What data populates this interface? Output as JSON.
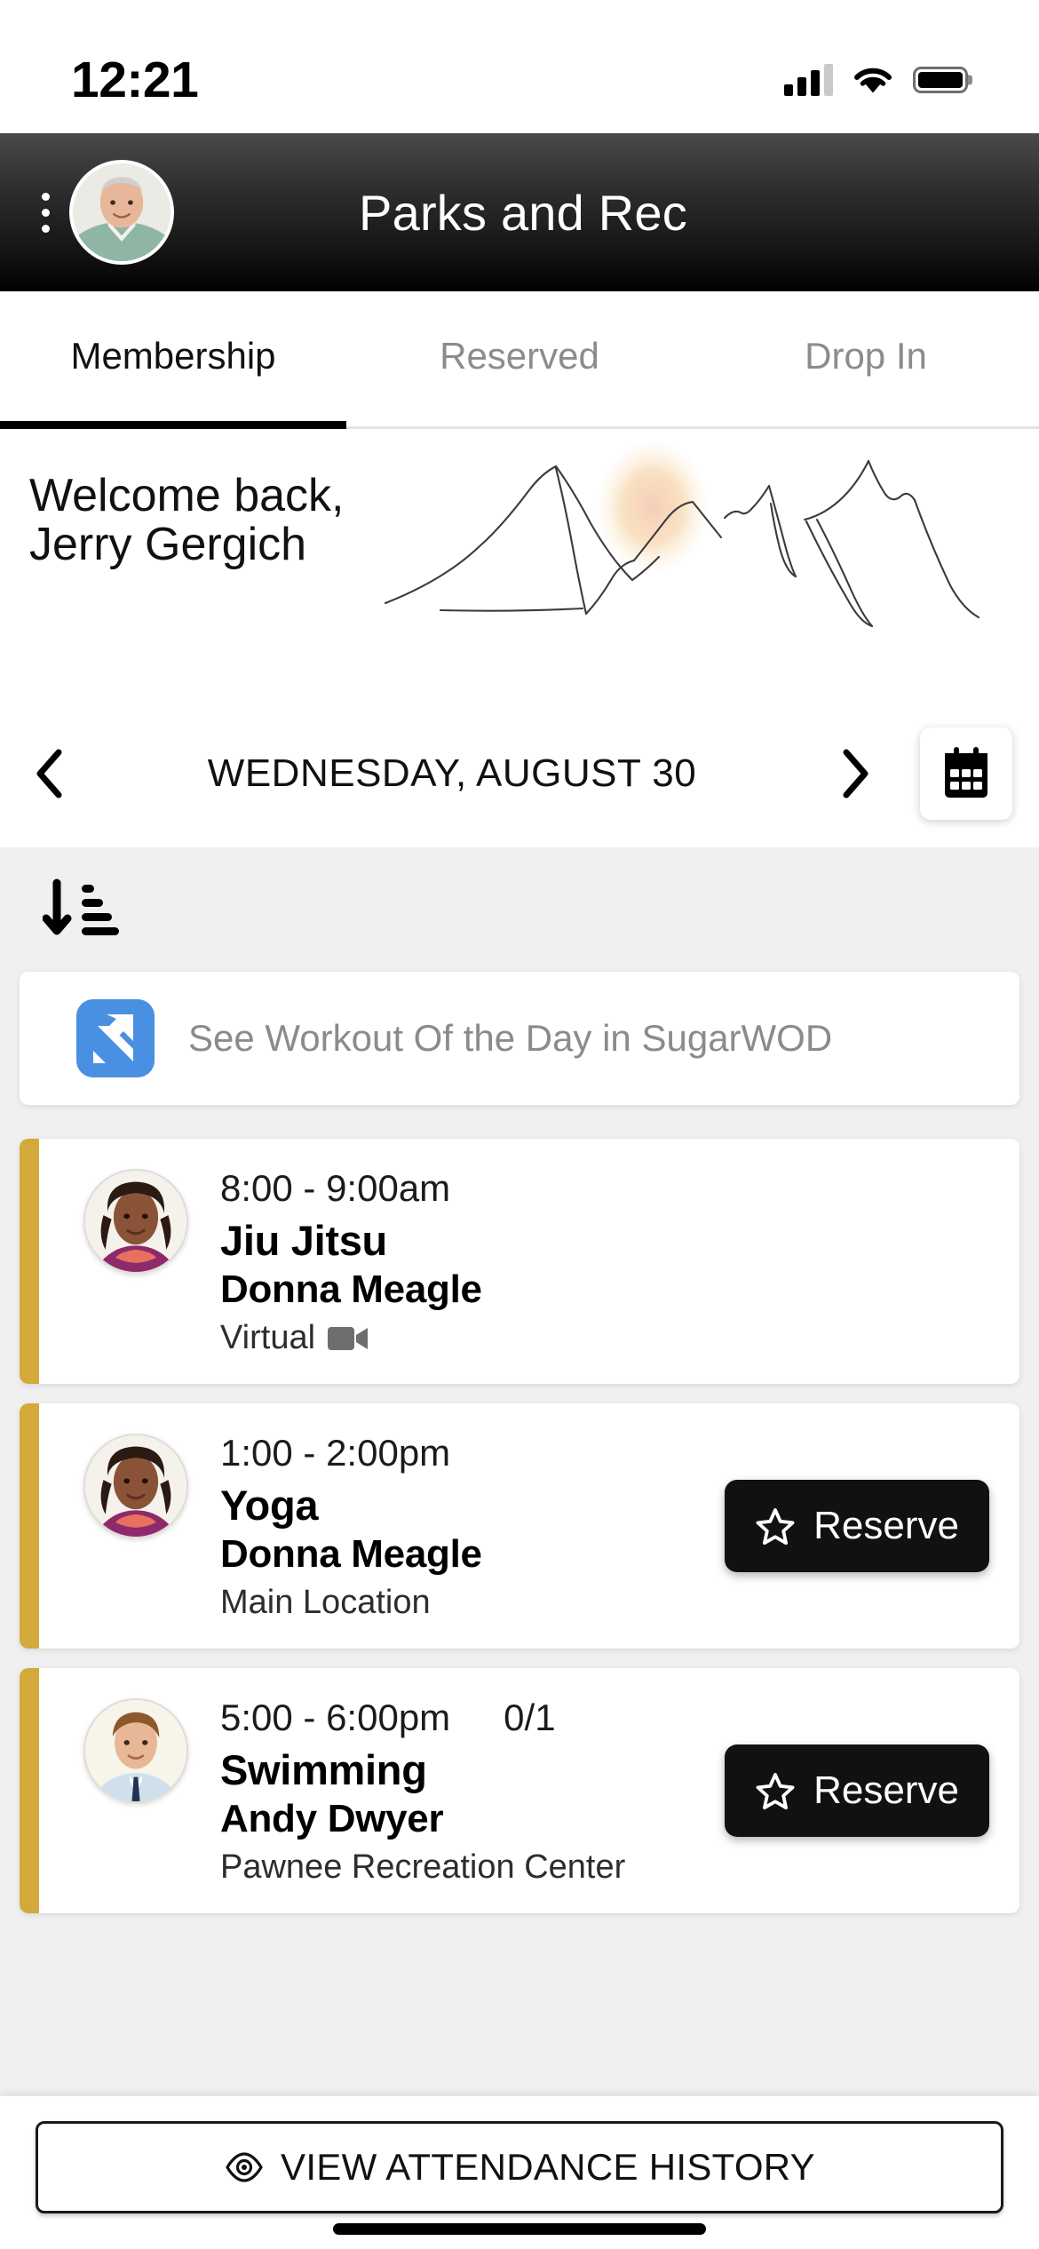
{
  "status_bar": {
    "time": "12:21",
    "signal_icon": "cellular-signal-icon",
    "wifi_icon": "wifi-icon",
    "battery_icon": "battery-icon"
  },
  "header": {
    "title": "Parks and Rec",
    "menu_icon": "kebab-menu-icon",
    "avatar_name": "Jerry Gergich"
  },
  "tabs": [
    {
      "label": "Membership",
      "active": true
    },
    {
      "label": "Reserved",
      "active": false
    },
    {
      "label": "Drop In",
      "active": false
    }
  ],
  "welcome": {
    "greeting": "Welcome back,\nJerry Gergich",
    "illustration": "mountain-range-illustration",
    "sun_color": "#f7d9b4"
  },
  "date_nav": {
    "prev_icon": "chevron-left-icon",
    "next_icon": "chevron-right-icon",
    "date": "WEDNESDAY, AUGUST 30",
    "calendar_icon": "calendar-icon"
  },
  "sort": {
    "icon": "sort-ascending-icon"
  },
  "wod": {
    "logo_icon": "sugarwod-logo-icon",
    "logo_color": "#4a90e2",
    "text": "See Workout Of the Day in SugarWOD"
  },
  "accent_color": "#d4a93c",
  "classes": [
    {
      "time": "8:00 - 9:00am",
      "count": "",
      "title": "Jiu Jitsu",
      "coach": "Donna Meagle",
      "location": "Virtual",
      "location_icon": "video-camera-icon",
      "reserve_label": "",
      "has_reserve": false
    },
    {
      "time": "1:00 - 2:00pm",
      "count": "",
      "title": "Yoga",
      "coach": "Donna Meagle",
      "location": "Main Location",
      "location_icon": "",
      "reserve_label": "Reserve",
      "reserve_icon": "star-icon",
      "has_reserve": true
    },
    {
      "time": "5:00 - 6:00pm",
      "count": "0/1",
      "title": "Swimming",
      "coach": "Andy Dwyer",
      "location": "Pawnee Recreation Center",
      "location_icon": "",
      "reserve_label": "Reserve",
      "reserve_icon": "star-icon",
      "has_reserve": true
    }
  ],
  "bottom": {
    "attendance_label": "VIEW ATTENDANCE HISTORY",
    "eye_icon": "eye-icon"
  }
}
